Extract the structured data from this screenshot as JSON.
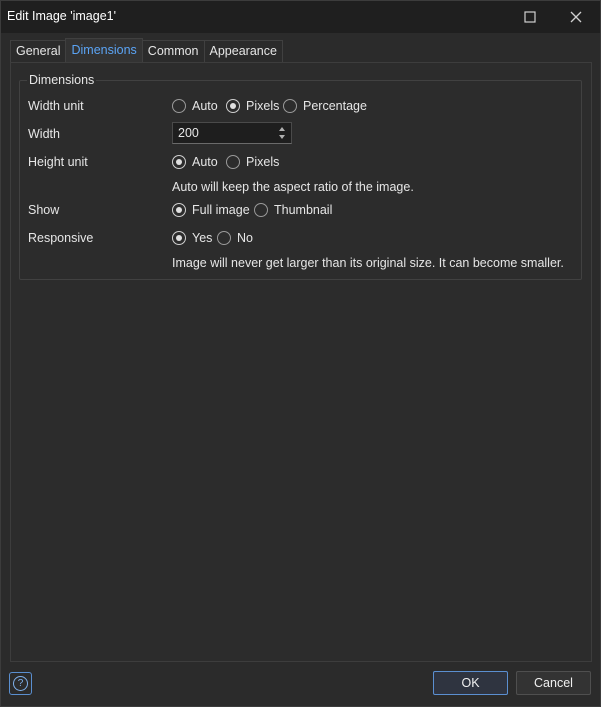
{
  "window": {
    "title": "Edit Image 'image1'"
  },
  "titlebar_icons": {
    "maximize": "maximize-icon",
    "close": "close-icon"
  },
  "tabs": [
    {
      "label": "General",
      "active": false
    },
    {
      "label": "Dimensions",
      "active": true
    },
    {
      "label": "Common",
      "active": false
    },
    {
      "label": "Appearance",
      "active": false
    }
  ],
  "group": {
    "legend": "Dimensions",
    "width_unit": {
      "label": "Width unit",
      "options": [
        "Auto",
        "Pixels",
        "Percentage"
      ],
      "selected": "Pixels"
    },
    "width": {
      "label": "Width",
      "value": "200"
    },
    "height_unit": {
      "label": "Height unit",
      "options": [
        "Auto",
        "Pixels"
      ],
      "selected": "Auto",
      "hint": "Auto will keep the aspect ratio of the image."
    },
    "show": {
      "label": "Show",
      "options": [
        "Full image",
        "Thumbnail"
      ],
      "selected": "Full image"
    },
    "responsive": {
      "label": "Responsive",
      "options": [
        "Yes",
        "No"
      ],
      "selected": "Yes",
      "hint": "Image will never get larger than its original size. It can become smaller."
    }
  },
  "footer": {
    "help_icon": "question-mark-icon",
    "help_glyph": "?",
    "ok_label": "OK",
    "cancel_label": "Cancel"
  },
  "colors": {
    "accent": "#5ba4f5",
    "background": "#2b2b2b"
  }
}
